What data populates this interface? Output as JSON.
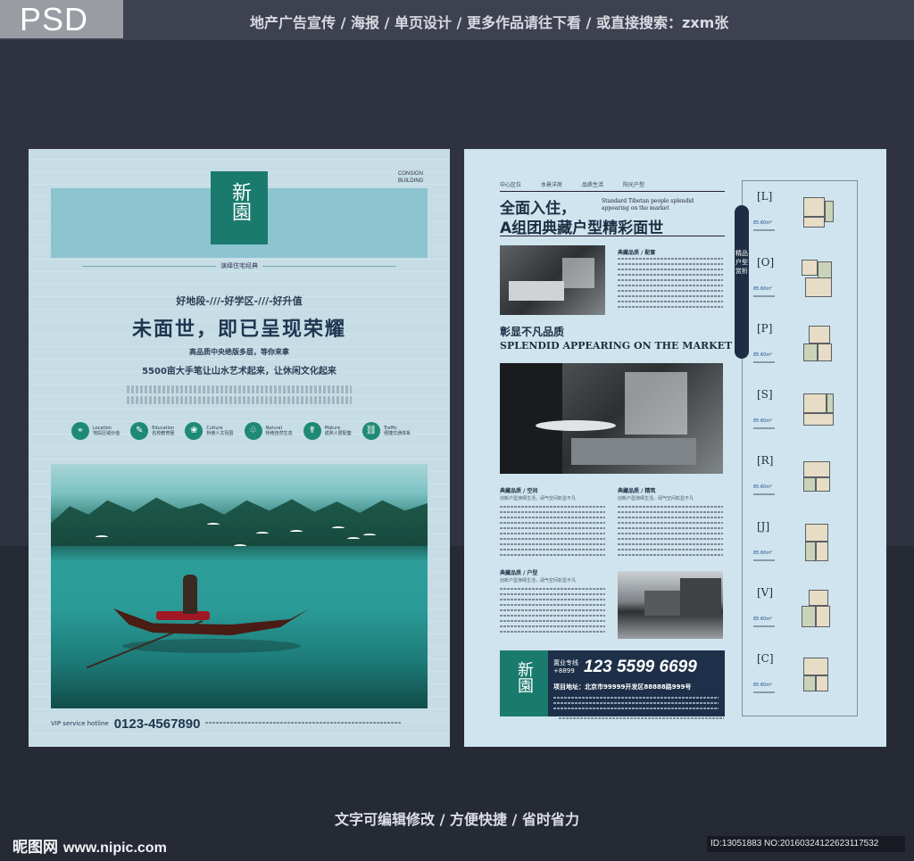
{
  "header": {
    "badge": "PSD",
    "title": "地产广告宣传 / 海报 / 单页设计 / 更多作品请往下看 / 或直接搜索：zxm张"
  },
  "poster_front": {
    "logo_text": "新園",
    "consign": "CONSIGN BUILDING",
    "subtitle": "演绎住宅经典",
    "tagline": "好地段-///-好学区-///-好升值",
    "headline": "未面世，即已呈现荣耀",
    "line1": "高品质中央绝版多层，等你来拿",
    "line2": "5500亩大手笔让山水艺术起来，让休闲文化起来",
    "features": [
      {
        "icon": "location-icon",
        "glyph": "⌖",
        "en": "Location",
        "cn": "地段区域价值"
      },
      {
        "icon": "education-icon",
        "glyph": "✎",
        "en": "Education",
        "cn": "名校教育圈"
      },
      {
        "icon": "culture-icon",
        "glyph": "❀",
        "en": "Culture",
        "cn": "桥南人文氛围"
      },
      {
        "icon": "nature-icon",
        "glyph": "♧",
        "en": "Natural",
        "cn": "桥南自然生态"
      },
      {
        "icon": "mature-icon",
        "glyph": "☤",
        "en": "Mature",
        "cn": "成熟人居配套"
      },
      {
        "icon": "traffic-icon",
        "glyph": "⛓",
        "en": "Traffic",
        "cn": "便捷交通体系"
      }
    ],
    "vip_label": "VIP service hotline",
    "phone": "0123-4567890"
  },
  "poster_back": {
    "tabs": [
      "中心区位",
      "水景洋房",
      "品质生活",
      "阳光户型"
    ],
    "headline1": "全面入住，",
    "headline1_en": "Standard Tibetan people splendid appearing on the market",
    "headline2": "A组团典藏户型精彩面世",
    "section_peitao": {
      "title": "典藏品质 / 配套"
    },
    "headline3": "彰显不凡品质",
    "headline3_en": "SPLENDID APPEARING ON THE MARKET",
    "section_kongjian": {
      "title": "典藏品质 / 空间",
      "sub": "创新户型演绎生活，阔气空间彰显不凡"
    },
    "section_jingzhu": {
      "title": "典藏品质 / 精筑",
      "sub": "创新户型演绎生活，阔气空间彰显不凡"
    },
    "section_huxing": {
      "title": "典藏品质 / 户型",
      "sub": "创新户型演绎生活，阔气空间彰显不凡"
    },
    "hotline_label": "置业专线 +8899",
    "hotline": "123 5599 6699",
    "address": "项目地址：北京市99999开发区88888路999号",
    "logo_text": "新園",
    "floorplan_title": "精品户型赏析",
    "floorplans": [
      {
        "letter": "[L]",
        "area": "85.60m²"
      },
      {
        "letter": "[O]",
        "area": "85.60m²"
      },
      {
        "letter": "[P]",
        "area": "85.60m²"
      },
      {
        "letter": "[S]",
        "area": "85.60m²"
      },
      {
        "letter": "[R]",
        "area": "85.60m²"
      },
      {
        "letter": "[J]",
        "area": "85.60m²"
      },
      {
        "letter": "[V]",
        "area": "85.60m²"
      },
      {
        "letter": "[C]",
        "area": "85.60m²"
      }
    ]
  },
  "footer": {
    "caption": "文字可编辑修改 / 方便快捷 / 省时省力",
    "watermark_cn": "昵图网",
    "watermark_site": "www.nipic.com",
    "image_id": "ID:13051883 NO:20160324122623117532"
  }
}
